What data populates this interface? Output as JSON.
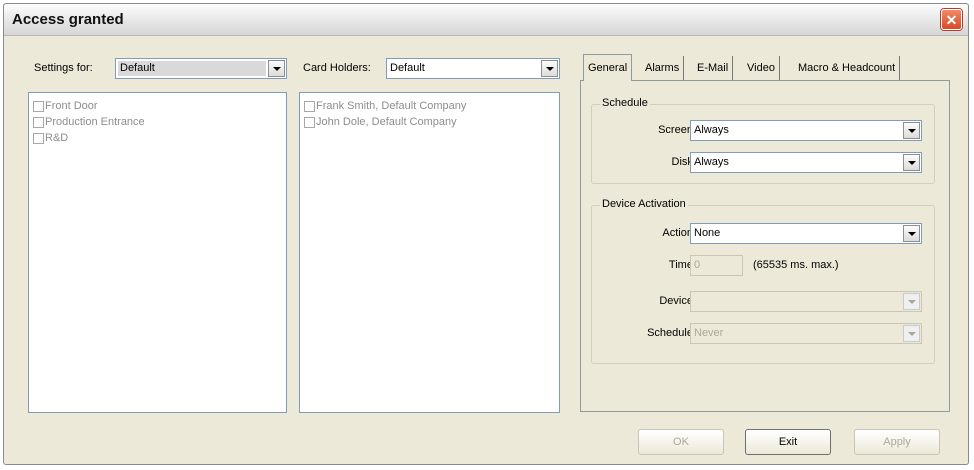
{
  "window": {
    "title": "Access granted"
  },
  "settings_for": {
    "label": "Settings for:",
    "value": "Default"
  },
  "card_holders": {
    "label": "Card Holders:",
    "value": "Default"
  },
  "doors": [
    "Front Door",
    "Production Entrance",
    "R&D"
  ],
  "holders": [
    "Frank Smith, Default Company",
    "John Dole, Default Company"
  ],
  "tabs": [
    "General",
    "Alarms",
    "E-Mail",
    "Video",
    "Macro & Headcount"
  ],
  "schedule": {
    "title": "Schedule",
    "screen_label": "Screen:",
    "screen_value": "Always",
    "disk_label": "Disk:",
    "disk_value": "Always"
  },
  "device_activation": {
    "title": "Device Activation",
    "action_label": "Action:",
    "action_value": "None",
    "time_label": "Time:",
    "time_value": "0",
    "time_hint": "(65535 ms. max.)",
    "device_label": "Device:",
    "device_value": "",
    "schedule_label": "Schedule:",
    "schedule_value": "Never"
  },
  "buttons": {
    "ok": "OK",
    "exit": "Exit",
    "apply": "Apply"
  }
}
